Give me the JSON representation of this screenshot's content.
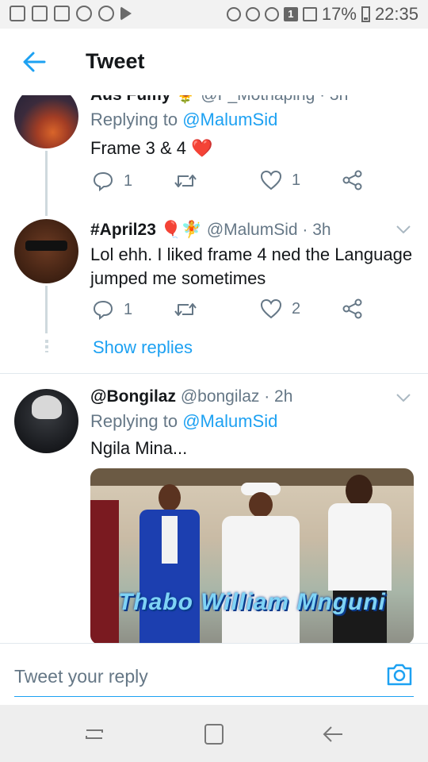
{
  "status_bar": {
    "battery": "17%",
    "time": "22:35",
    "sim_badge": "1"
  },
  "header": {
    "title": "Tweet"
  },
  "tweets": [
    {
      "name": "Aus Fumy",
      "handle": "@F_Mothaping",
      "time": "· 3h",
      "replying_label": "Replying to",
      "replying_to": "@MalumSid",
      "text": "Frame 3 & 4 ❤️",
      "replies": "1",
      "retweets": "",
      "likes": "1"
    },
    {
      "name": "#April23 🎈🧚",
      "handle": "@MalumSid",
      "time": "· 3h",
      "text": "Lol ehh. I liked frame 4 ned the Language jumped me sometimes",
      "replies": "1",
      "retweets": "",
      "likes": "2",
      "show_replies": "Show replies"
    },
    {
      "name": "@Bongilaz",
      "handle": "@bongilaz",
      "time": "· 2h",
      "replying_label": "Replying to",
      "replying_to": "@MalumSid",
      "text": "Ngila Mina...",
      "media_caption": "Thabo William Mnguni"
    }
  ],
  "composer": {
    "placeholder": "Tweet your reply"
  },
  "colors": {
    "accent": "#1da1f2",
    "text": "#14171a",
    "muted": "#657786",
    "heart": "#e0245e"
  },
  "icons": [
    "back-arrow-icon",
    "reply-icon",
    "retweet-icon",
    "like-icon",
    "share-icon",
    "chevron-down-icon",
    "camera-icon",
    "recents-icon",
    "home-icon",
    "back-icon"
  ]
}
